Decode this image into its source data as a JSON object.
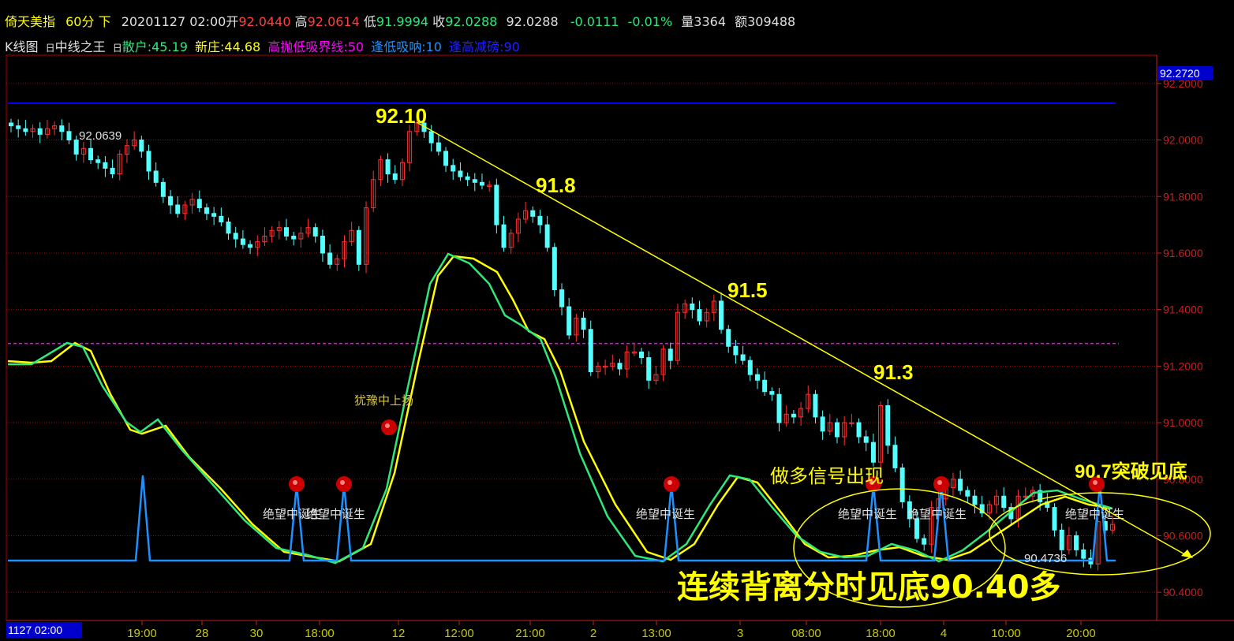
{
  "header": {
    "title": "倚天美指",
    "period": "60分",
    "direction": "下",
    "datetime": "20201127 02:00",
    "open_label": "开",
    "open_value": "92.0440",
    "high_label": "高",
    "high_value": "92.0614",
    "low_label": "低",
    "low_value": "91.9994",
    "close_label": "收",
    "close_value": "92.0288",
    "last_value": "92.0288",
    "change": "-0.0111",
    "change_pct": "-0.01%",
    "volume_label": "量",
    "volume_value": "3364",
    "amount_label": "额",
    "amount_value": "309488"
  },
  "indicator_bar": {
    "kline_label": "K线图",
    "box1": "日",
    "indicator_name": "中线之王",
    "box2": "日",
    "retail_label": "散户:45.19",
    "newbanker_label": "新庄:44.68",
    "line_label": "高抛低吸界线:50",
    "low_buy_label": "逢低吸呐:10",
    "high_reduce_label": "逢高减磅:90"
  },
  "colors": {
    "background": "#000000",
    "up": "#ff3232",
    "down": "#54ffff",
    "grid": "#b00000",
    "price_axis_text": "#c81e1e",
    "yellow": "#ffff00",
    "green": "#2ee87a",
    "magenta": "#ff00ff",
    "blue_line": "#0000ff",
    "signal_line": "#1e90ff",
    "time_axis_text": "#c8c800"
  },
  "chart_data": {
    "type": "candlestick",
    "ylim": [
      90.3,
      92.3
    ],
    "price_ticks": [
      "92.2000",
      "92.0000",
      "91.8000",
      "91.6000",
      "91.4000",
      "91.2000",
      "91.0000",
      "90.8000",
      "90.6000",
      "90.4000"
    ],
    "top_price_label": "92.2720",
    "time_ticks": [
      "1127 02:00",
      "19:00",
      "28",
      "30",
      "18:00",
      "12",
      "12:00",
      "21:00",
      "2",
      "13:00",
      "3",
      "08:00",
      "18:00",
      "4",
      "10:00",
      "20:00"
    ],
    "high_marker": "92.0639",
    "low_marker": "90.4736",
    "resistance_level": 92.13,
    "boundary_level": 91.28,
    "closes": [
      92.05,
      92.04,
      92.03,
      92.04,
      92.02,
      92.04,
      92.05,
      92.03,
      92.0,
      91.95,
      91.97,
      91.93,
      91.92,
      91.9,
      91.88,
      91.95,
      91.98,
      92.0,
      91.96,
      91.89,
      91.85,
      91.8,
      91.77,
      91.74,
      91.77,
      91.79,
      91.76,
      91.74,
      91.73,
      91.71,
      91.67,
      91.65,
      91.63,
      91.62,
      91.64,
      91.66,
      91.68,
      91.69,
      91.66,
      91.65,
      91.67,
      91.69,
      91.66,
      91.6,
      91.56,
      91.58,
      91.64,
      91.68,
      91.56,
      91.76,
      91.86,
      91.93,
      91.88,
      91.86,
      91.92,
      92.03,
      92.06,
      92.03,
      91.99,
      91.96,
      91.91,
      91.89,
      91.87,
      91.86,
      91.85,
      91.84,
      91.84,
      91.7,
      91.62,
      91.67,
      91.72,
      91.75,
      91.73,
      91.7,
      91.62,
      91.47,
      91.41,
      91.31,
      91.37,
      91.33,
      91.18,
      91.2,
      91.2,
      91.21,
      91.19,
      91.25,
      91.25,
      91.23,
      91.15,
      91.17,
      91.26,
      91.22,
      91.39,
      91.42,
      91.4,
      91.36,
      91.39,
      91.43,
      91.33,
      91.27,
      91.24,
      91.22,
      91.17,
      91.15,
      91.11,
      91.1,
      91.0,
      91.03,
      91.02,
      91.05,
      91.1,
      91.02,
      90.97,
      91.0,
      90.95,
      91.0,
      91.0,
      90.95,
      90.93,
      90.86,
      91.06,
      90.92,
      90.84,
      90.72,
      90.66,
      90.59,
      90.57,
      90.7,
      90.73,
      90.77,
      90.8,
      90.76,
      90.74,
      90.71,
      90.68,
      90.71,
      90.74,
      90.7,
      90.66,
      90.74,
      90.74,
      90.76,
      90.72,
      90.7,
      90.62,
      90.55,
      90.6,
      90.55,
      90.52,
      90.5,
      90.65,
      90.62,
      90.64
    ]
  },
  "annotations": {
    "peak_label": "92.10",
    "label_918": "91.8",
    "label_915": "91.5",
    "label_913": "91.3",
    "label_907": "90.7突破见底",
    "long_signal": "做多信号出现",
    "bottom_text": "连续背离分时见底90.40多",
    "hesitate_label": "犹豫中上扬",
    "signal_labels": [
      "绝望中诞生",
      "绝望中诞生",
      "绝望中诞生",
      "绝望中诞生",
      "绝望中诞生",
      "绝望中诞生"
    ]
  }
}
